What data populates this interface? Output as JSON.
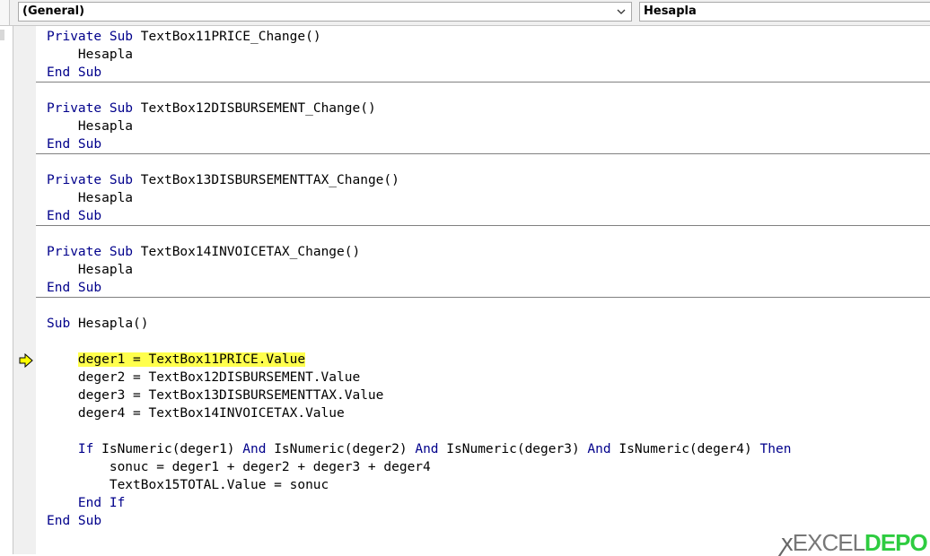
{
  "toolbar": {
    "object_dropdown": "(General)",
    "procedure_dropdown": "Hesapla"
  },
  "code": {
    "lines": [
      "Private Sub TextBox11PRICE_Change()",
      "    Hesapla",
      "End Sub",
      "Private Sub TextBox12DISBURSEMENT_Change()",
      "    Hesapla",
      "End Sub",
      "Private Sub TextBox13DISBURSEMENTTAX_Change()",
      "    Hesapla",
      "End Sub",
      "Private Sub TextBox14INVOICETAX_Change()",
      "    Hesapla",
      "End Sub",
      "Sub Hesapla()",
      "    deger1 = TextBox11PRICE.Value",
      "    deger2 = TextBox12DISBURSEMENT.Value",
      "    deger3 = TextBox13DISBURSEMENTTAX.Value",
      "    deger4 = TextBox14INVOICETAX.Value",
      "    If IsNumeric(deger1) And IsNumeric(deger2) And IsNumeric(deger3) And IsNumeric(deger4) Then",
      "        sonuc = deger1 + deger2 + deger3 + deger4",
      "        TextBox15TOTAL.Value = sonuc",
      "    End If",
      "End Sub"
    ],
    "current_line": "    deger1 = TextBox11PRICE.Value"
  },
  "watermark": {
    "part1": "EXCEL",
    "part2": "DEPO"
  },
  "colors": {
    "keyword": "#00008b",
    "highlight": "#ffff4d",
    "separator": "#808080",
    "exec_arrow": "#ffff00"
  }
}
